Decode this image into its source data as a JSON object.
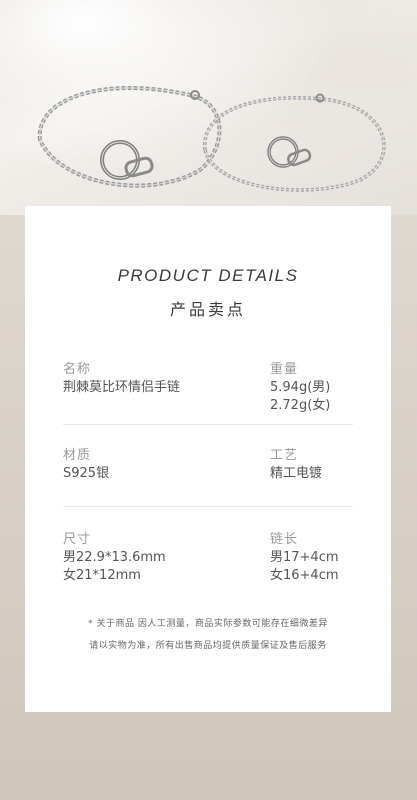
{
  "details": {
    "title_en": "PRODUCT DETAILS",
    "title_cn": "产品卖点",
    "name_label": "名称",
    "name_value": "荆棘莫比环情侣手链",
    "weight_label": "重量",
    "weight_male": "5.94g(男)",
    "weight_female": "2.72g(女)",
    "material_label": "材质",
    "material_value": "S925银",
    "craft_label": "工艺",
    "craft_value": "精工电镀",
    "size_label": "尺寸",
    "size_male": "男22.9*13.6mm",
    "size_female": "女21*12mm",
    "chain_label": "链长",
    "chain_male": "男17+4cm",
    "chain_female": "女16+4cm",
    "note_line1": "* 关于商品 因人工测量，商品实际参数可能存在细微差异",
    "note_line2": "请以实物为准，所有出售商品均提供质量保证及售后服务"
  }
}
